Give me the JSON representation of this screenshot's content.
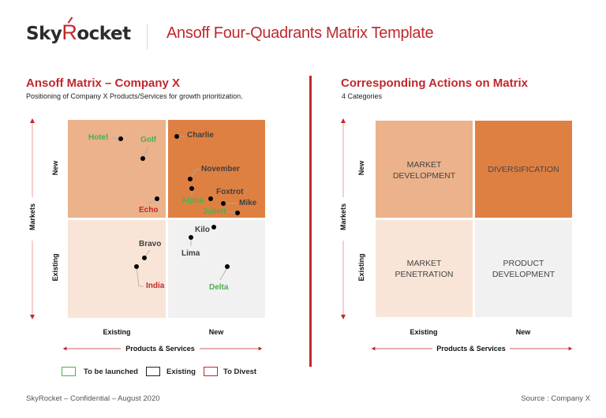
{
  "header": {
    "logo_prefix": "Sky",
    "logo_r": "R",
    "logo_suffix": "ocket",
    "title": "Ansoff Four-Quadrants Matrix Template"
  },
  "left": {
    "title": "Ansoff Matrix – Company X",
    "subtitle": "Positioning of Company X Products/Services for growth prioritization.",
    "y_axis_label": "Markets",
    "y_ticks": [
      "New",
      "Existing"
    ],
    "x_ticks": [
      "Existing",
      "New"
    ],
    "x_axis_label": "Products & Services",
    "points": [
      {
        "name": "Hotel",
        "status": "launch",
        "quadrant": "market_development"
      },
      {
        "name": "Golf",
        "status": "launch",
        "quadrant": "market_development"
      },
      {
        "name": "Echo",
        "status": "divest",
        "quadrant": "market_development"
      },
      {
        "name": "Charlie",
        "status": "existing",
        "quadrant": "diversification"
      },
      {
        "name": "November",
        "status": "existing",
        "quadrant": "diversification"
      },
      {
        "name": "Alpha",
        "status": "launch",
        "quadrant": "diversification"
      },
      {
        "name": "Foxtrot",
        "status": "existing",
        "quadrant": "diversification"
      },
      {
        "name": "Mike",
        "status": "existing",
        "quadrant": "diversification"
      },
      {
        "name": "Juliett",
        "status": "launch",
        "quadrant": "diversification"
      },
      {
        "name": "Bravo",
        "status": "existing",
        "quadrant": "market_penetration"
      },
      {
        "name": "India",
        "status": "divest",
        "quadrant": "market_penetration"
      },
      {
        "name": "Kilo",
        "status": "existing",
        "quadrant": "product_development"
      },
      {
        "name": "Lima",
        "status": "existing",
        "quadrant": "product_development"
      },
      {
        "name": "Delta",
        "status": "launch",
        "quadrant": "product_development"
      }
    ],
    "legend": [
      {
        "label": "To be launched",
        "color": "#4caf50"
      },
      {
        "label": "Existing",
        "color": "#222222"
      },
      {
        "label": "To Divest",
        "color": "#c0282d"
      }
    ]
  },
  "right": {
    "title": "Corresponding Actions on Matrix",
    "subtitle": "4 Categories",
    "y_axis_label": "Markets",
    "y_ticks": [
      "New",
      "Existing"
    ],
    "x_ticks": [
      "Existing",
      "New"
    ],
    "x_axis_label": "Products & Services",
    "quadrants": {
      "top_left": [
        "MARKET",
        "DEVELOPMENT"
      ],
      "top_right": [
        "DIVERSIFICATION"
      ],
      "bottom_left": [
        "MARKET",
        "PENETRATION"
      ],
      "bottom_right": [
        "PRODUCT",
        "DEVELOPMENT"
      ]
    }
  },
  "colors": {
    "brand_red": "#c0282d",
    "market_development": "#ebb28b",
    "diversification": "#df8043",
    "market_penetration": "#f8e5d8",
    "product_development": "#f1f1f1"
  },
  "footer": {
    "left": "SkyRocket – Confidential – August 2020",
    "right": "Source : Company X"
  }
}
